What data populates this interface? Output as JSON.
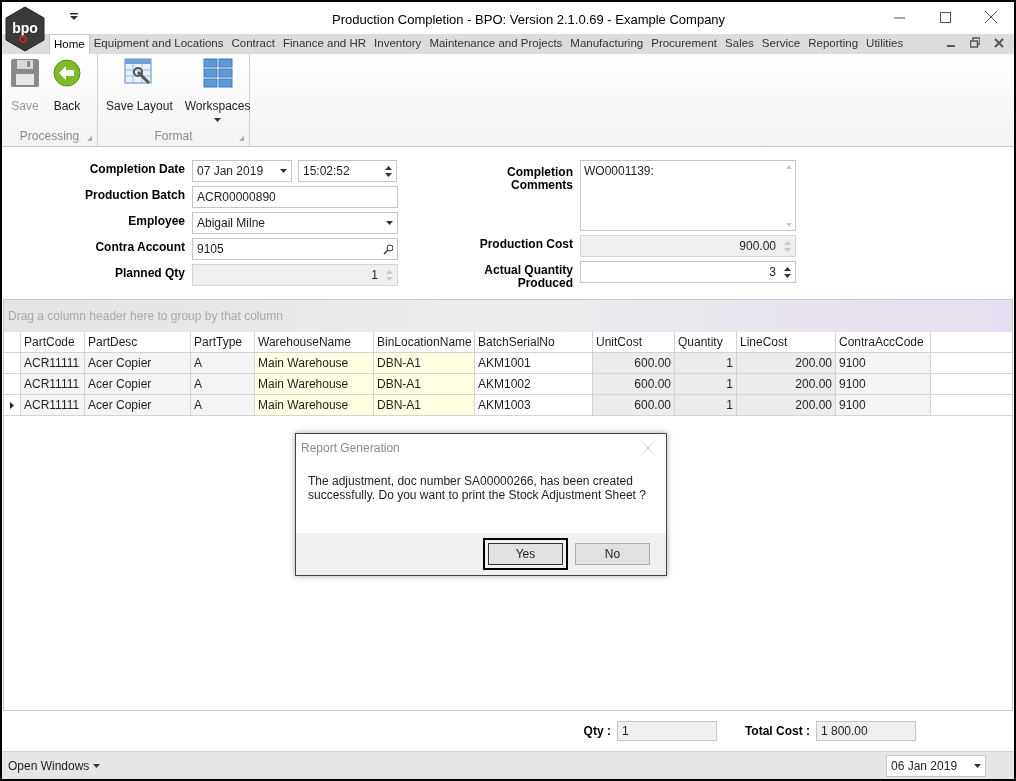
{
  "window": {
    "title": "Production Completion - BPO: Version 2.1.0.69 - Example Company",
    "logo": "bpo"
  },
  "tabs": [
    {
      "label": "Home",
      "selected": true
    },
    {
      "label": "Equipment and Locations",
      "selected": false
    },
    {
      "label": "Contract",
      "selected": false
    },
    {
      "label": "Finance and HR",
      "selected": false
    },
    {
      "label": "Inventory",
      "selected": false
    },
    {
      "label": "Maintenance and Projects",
      "selected": false
    },
    {
      "label": "Manufacturing",
      "selected": false
    },
    {
      "label": "Procurement",
      "selected": false
    },
    {
      "label": "Sales",
      "selected": false
    },
    {
      "label": "Service",
      "selected": false
    },
    {
      "label": "Reporting",
      "selected": false
    },
    {
      "label": "Utilities",
      "selected": false
    }
  ],
  "ribbon": {
    "groups": [
      {
        "label": "Processing",
        "buttons": [
          {
            "label": "Save",
            "kind": "save",
            "disabled": true,
            "dropdown": false
          },
          {
            "label": "Back",
            "kind": "back",
            "disabled": false,
            "dropdown": false
          }
        ]
      },
      {
        "label": "Format",
        "buttons": [
          {
            "label": "Save Layout",
            "kind": "layout",
            "disabled": false,
            "dropdown": false
          },
          {
            "label": "Workspaces",
            "kind": "workspaces",
            "disabled": false,
            "dropdown": true
          }
        ]
      }
    ]
  },
  "form": {
    "left": [
      {
        "label": "Completion Date",
        "kind": "datetime",
        "value": "07 Jan 2019",
        "time": "15:02:52",
        "disabled": false
      },
      {
        "label": "Production Batch",
        "kind": "text",
        "value": "ACR00000890",
        "disabled": false
      },
      {
        "label": "Employee",
        "kind": "dropdown",
        "value": "Abigail Milne",
        "disabled": false
      },
      {
        "label": "Contra Account",
        "kind": "lookup",
        "value": "9105",
        "disabled": false
      },
      {
        "label": "Planned Qty",
        "kind": "spin",
        "value": "1",
        "disabled": true
      }
    ],
    "right": [
      {
        "label": "Completion Comments",
        "kind": "memo",
        "value": "WO0001139:",
        "disabled": false
      },
      {
        "label": "Production Cost",
        "kind": "spin",
        "value": "900.00",
        "disabled": true
      },
      {
        "label": "Actual Quantity Produced",
        "kind": "spin",
        "value": "3",
        "disabled": false
      }
    ]
  },
  "grid": {
    "group_hint": "Drag a column header here to group by that column",
    "columns": [
      {
        "name": "PartCode",
        "kind": "plain"
      },
      {
        "name": "PartDesc",
        "kind": "plain"
      },
      {
        "name": "PartType",
        "kind": "plain"
      },
      {
        "name": "WarehouseName",
        "kind": "lookup"
      },
      {
        "name": "BinLocationName",
        "kind": "lookup"
      },
      {
        "name": "BatchSerialNo",
        "kind": "editable"
      },
      {
        "name": "UnitCost",
        "kind": "readonly"
      },
      {
        "name": "Quantity",
        "kind": "readonly"
      },
      {
        "name": "LineCost",
        "kind": "readonly"
      },
      {
        "name": "ContraAccCode",
        "kind": "plain"
      }
    ],
    "rows": [
      {
        "selected": false,
        "cells": [
          "ACR11111",
          "Acer Copier",
          "A",
          "Main Warehouse",
          "DBN-A1",
          "AKM1001",
          "600.00",
          "1",
          "200.00",
          "9100"
        ]
      },
      {
        "selected": false,
        "cells": [
          "ACR11111",
          "Acer Copier",
          "A",
          "Main Warehouse",
          "DBN-A1",
          "AKM1002",
          "600.00",
          "1",
          "200.00",
          "9100"
        ]
      },
      {
        "selected": true,
        "cells": [
          "ACR11111",
          "Acer Copier",
          "A",
          "Main Warehouse",
          "DBN-A1",
          "AKM1003",
          "600.00",
          "1",
          "200.00",
          "9100"
        ]
      }
    ]
  },
  "totals": [
    {
      "label": "Qty :",
      "value": "1"
    },
    {
      "label": "Total Cost :",
      "value": "1 800.00"
    }
  ],
  "status_bar": {
    "open_windows": "Open Windows",
    "date": "06 Jan 2019"
  },
  "dialog": {
    "title": "Report Generation",
    "message": "The adjustment, doc number SA00000266, has been created successfully. Do you want to print the Stock Adjustment Sheet ?",
    "buttons": [
      {
        "label": "Yes",
        "selected": true
      },
      {
        "label": "No",
        "selected": false
      }
    ]
  }
}
